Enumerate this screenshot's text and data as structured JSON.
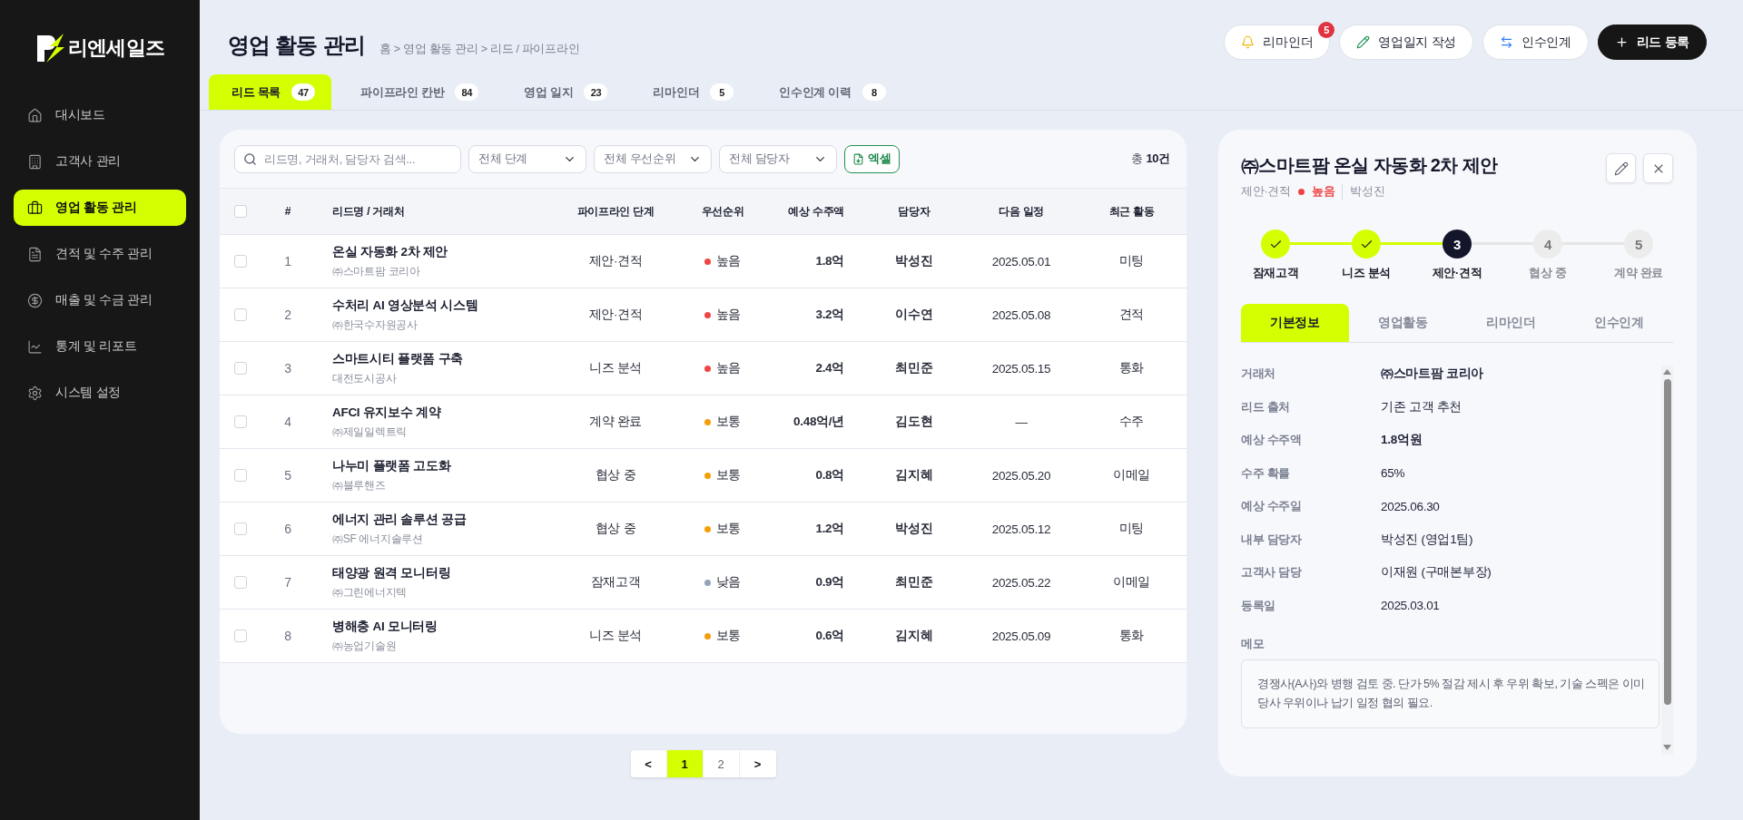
{
  "sidebar": {
    "logo": "리엔세일즈",
    "items": [
      {
        "label": "대시보드",
        "selected": false
      },
      {
        "label": "고객사 관리",
        "selected": false
      },
      {
        "label": "영업 활동 관리",
        "selected": true
      },
      {
        "label": "견적 및 수주 관리",
        "selected": false
      },
      {
        "label": "매출 및 수금 관리",
        "selected": false
      },
      {
        "label": "통계 및 리포트",
        "selected": false
      },
      {
        "label": "시스템 설정",
        "selected": false
      }
    ]
  },
  "header": {
    "title": "영업 활동 관리",
    "breadcrumb": "홈 > 영업 활동 관리 > 리드 / 파이프라인",
    "actions": [
      {
        "label": "리마인더",
        "kind": "outline",
        "badge": "5"
      },
      {
        "label": "영업일지 작성",
        "kind": "outline"
      },
      {
        "label": "인수인계",
        "kind": "outline"
      },
      {
        "label": "리드 등록",
        "kind": "primary"
      }
    ]
  },
  "tabs": [
    {
      "label": "리드 목록",
      "count": "47",
      "selected": true
    },
    {
      "label": "파이프라인 칸반",
      "count": "84",
      "selected": false
    },
    {
      "label": "영업 일지",
      "count": "23",
      "selected": false
    },
    {
      "label": "리마인더",
      "count": "5",
      "selected": false
    },
    {
      "label": "인수인계 이력",
      "count": "8",
      "selected": false
    }
  ],
  "toolbar": {
    "search": {
      "placeholder": "리드명, 거래처, 담당자 검색..."
    },
    "filters": [
      "전체 단계",
      "전체 우선순위",
      "전체 담당자"
    ],
    "export": "엑셀",
    "total": "총 **10건**"
  },
  "table": {
    "select_all": {
      "checked": false
    },
    "columns": [
      "#",
      "리드명 / 거래처",
      "파이프라인 단계",
      "우선순위",
      "예상 수주액",
      "담당자",
      "다음 일정",
      "최근 활동"
    ],
    "rows": [
      {
        "checked": false,
        "number": "1",
        "title": "온실 자동화 2차 제안",
        "company": "㈜스마트팜 코리아",
        "stage": "제안·견적",
        "priority": {
          "label": "높음",
          "color": "#ef4444"
        },
        "amount": "1.8억",
        "owner": "박성진",
        "next_date": "2025.05.01",
        "last_activity": "미팅"
      },
      {
        "checked": false,
        "number": "2",
        "title": "수처리 AI 영상분석 시스템",
        "company": "㈜한국수자원공사",
        "stage": "제안·견적",
        "priority": {
          "label": "높음",
          "color": "#ef4444"
        },
        "amount": "3.2억",
        "owner": "이수연",
        "next_date": "2025.05.08",
        "last_activity": "견적"
      },
      {
        "checked": false,
        "number": "3",
        "title": "스마트시티 플랫폼 구축",
        "company": "대전도시공사",
        "stage": "니즈 분석",
        "priority": {
          "label": "높음",
          "color": "#ef4444"
        },
        "amount": "2.4억",
        "owner": "최민준",
        "next_date": "2025.05.15",
        "last_activity": "통화"
      },
      {
        "checked": false,
        "number": "4",
        "title": "AFCI 유지보수 계약",
        "company": "㈜제일일렉트릭",
        "stage": "계약 완료",
        "priority": {
          "label": "보통",
          "color": "#f59e0b"
        },
        "amount": "0.48억/년",
        "owner": "김도현",
        "next_date": "—",
        "last_activity": "수주"
      },
      {
        "checked": false,
        "number": "5",
        "title": "나누미 플랫폼 고도화",
        "company": "㈜블루핸즈",
        "stage": "협상 중",
        "priority": {
          "label": "보통",
          "color": "#f59e0b"
        },
        "amount": "0.8억",
        "owner": "김지혜",
        "next_date": "2025.05.20",
        "last_activity": "이메일"
      },
      {
        "checked": false,
        "number": "6",
        "title": "에너지 관리 솔루션 공급",
        "company": "㈜SF 에너지솔루션",
        "stage": "협상 중",
        "priority": {
          "label": "보통",
          "color": "#f59e0b"
        },
        "amount": "1.2억",
        "owner": "박성진",
        "next_date": "2025.05.12",
        "last_activity": "미팅"
      },
      {
        "checked": false,
        "number": "7",
        "title": "태양광 원격 모니터링",
        "company": "㈜그린에너지텍",
        "stage": "잠재고객",
        "priority": {
          "label": "낮음",
          "color": "#94a3b8"
        },
        "amount": "0.9억",
        "owner": "최민준",
        "next_date": "2025.05.22",
        "last_activity": "이메일"
      },
      {
        "checked": false,
        "number": "8",
        "title": "병해충 AI 모니터링",
        "company": "㈜농업기술원",
        "stage": "니즈 분석",
        "priority": {
          "label": "보통",
          "color": "#f59e0b"
        },
        "amount": "0.6억",
        "owner": "김지혜",
        "next_date": "2025.05.09",
        "last_activity": "통화"
      }
    ]
  },
  "pagination": {
    "prev": "<",
    "pages": [
      {
        "label": "1",
        "selected": true
      },
      {
        "label": "2",
        "selected": false
      }
    ],
    "next": ">"
  },
  "detail": {
    "title": "㈜스마트팜 온실 자동화 2차 제안",
    "stage": "제안·견적",
    "priority": {
      "label": "높음",
      "color": "#ef4444"
    },
    "owner": "박성진",
    "steps": [
      {
        "label": "잠재고객",
        "done": true,
        "selected": false
      },
      {
        "label": "니즈 분석",
        "done": true,
        "selected": false
      },
      {
        "number": "3",
        "label": "제안·견적",
        "done": false,
        "selected": true
      },
      {
        "number": "4",
        "label": "협상 중",
        "done": false,
        "selected": false
      },
      {
        "number": "5",
        "label": "계약 완료",
        "done": false,
        "selected": false
      }
    ],
    "tabs": [
      {
        "label": "기본정보",
        "selected": true
      },
      {
        "label": "영업활동",
        "selected": false
      },
      {
        "label": "리마인더",
        "selected": false
      },
      {
        "label": "인수인계",
        "selected": false
      }
    ],
    "fields": [
      {
        "label": "거래처",
        "value": "㈜스마트팜 코리아",
        "kind": "highlight"
      },
      {
        "label": "리드 출처",
        "value": "기존 고객 추천",
        "kind": "plain"
      },
      {
        "label": "예상 수주액",
        "value": "1.8억원",
        "kind": "highlight"
      },
      {
        "label": "수주 확률",
        "value": "65%",
        "kind": "plain"
      },
      {
        "label": "예상 수주일",
        "value": "2025.06.30",
        "kind": "plain"
      },
      {
        "label": "내부 담당자",
        "value": "박성진 (영업1팀)",
        "kind": "plain"
      },
      {
        "label": "고객사 담당",
        "value": "이재원 (구매본부장)",
        "kind": "plain"
      },
      {
        "label": "등록일",
        "value": "2025.03.01",
        "kind": "plain"
      }
    ],
    "memo": {
      "label": "메모",
      "text": "경쟁사(A사)와 병행 검토 중. 단가 5% 절감 제시 후 우위 확보, 기술 스펙은 이미 당사 우위이나 납기 일정 협의 필요."
    }
  }
}
